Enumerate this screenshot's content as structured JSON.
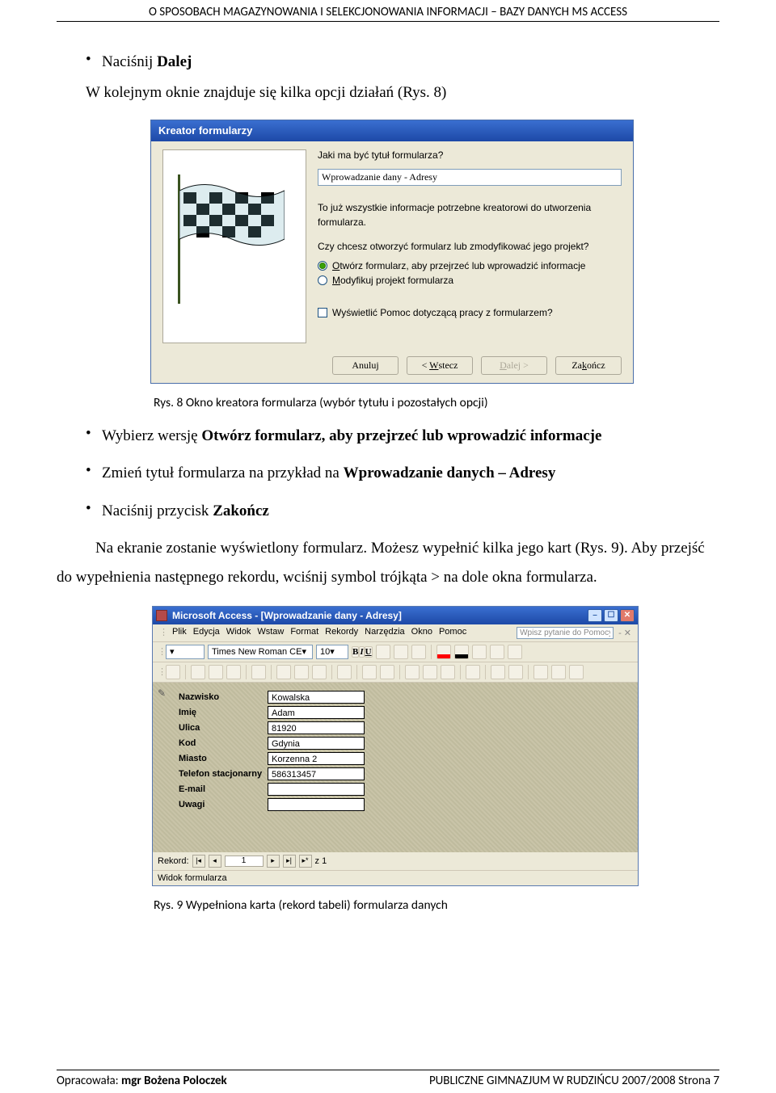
{
  "header": "O SPOSOBACH MAGAZYNOWANIA I SELEKCJONOWANIA INFORMACJI – BAZY DANYCH MS ACCESS",
  "footer": {
    "left_prefix": "Opracowała: ",
    "left_bold": "mgr Bożena Poloczek",
    "right": "PUBLICZNE GIMNAZJUM W RUDZIŃCU 2007/2008       Strona 7"
  },
  "intro": {
    "bullet1": "Naciśnij ",
    "bullet1_bold": "Dalej",
    "line2": "W kolejnym oknie znajduje się kilka opcji działań (Rys. 8)"
  },
  "wizard": {
    "title": "Kreator formularzy",
    "question": "Jaki ma być tytuł formularza?",
    "input_value": "Wprowadzanie dany - Adresy",
    "para1": "To już wszystkie informacje potrzebne kreatorowi do utworzenia formularza.",
    "para2": "Czy chcesz otworzyć formularz lub zmodyfikować jego projekt?",
    "radio1_u": "O",
    "radio1_rest": "twórz formularz, aby przejrzeć lub wprowadzić informacje",
    "radio2_u": "M",
    "radio2_rest": "odyfikuj projekt formularza",
    "check": "Wyświetlić Pomoc dotyczącą pracy z formularzem?",
    "btn_cancel": "Anuluj",
    "btn_back_pref": "< ",
    "btn_back_u": "W",
    "btn_back_rest": "stecz",
    "btn_next_u": "D",
    "btn_next_rest": "alej >",
    "btn_finish": "Za",
    "btn_finish_u": "k",
    "btn_finish_rest": "ończ"
  },
  "caption1": "Rys. 8  Okno kreatora formularza (wybór tytułu i pozostałych opcji)",
  "mid_bullets": {
    "b1_a": "Wybierz wersję ",
    "b1_b": "Otwórz formularz, aby przejrzeć lub wprowadzić informacje",
    "b2_a": "Zmień tytuł formularza na przykład na ",
    "b2_b": "Wprowadzanie danych – Adresy",
    "b3_a": "Naciśnij przycisk ",
    "b3_b": "Zakończ"
  },
  "bodytext": "Na ekranie zostanie wyświetlony formularz. Możesz wypełnić kilka jego kart (Rys. 9). Aby przejść do wypełnienia następnego rekordu, wciśnij symbol trójkąta > na dole okna formularza.",
  "access": {
    "title": "Microsoft Access - [Wprowadzanie dany - Adresy]",
    "menu": [
      "Plik",
      "Edycja",
      "Widok",
      "Wstaw",
      "Format",
      "Rekordy",
      "Narzędzia",
      "Okno",
      "Pomoc"
    ],
    "help_placeholder": "Wpisz pytanie do Pomocy",
    "help_sfx": "- ✕",
    "font_name": "Times New Roman CE",
    "font_size": "10",
    "fmt_btns": [
      "B",
      "I",
      "U"
    ],
    "fields": [
      {
        "label": "Nazwisko",
        "value": "Kowalska"
      },
      {
        "label": "Imię",
        "value": "Adam"
      },
      {
        "label": "Ulica",
        "value": "81920"
      },
      {
        "label": "Kod",
        "value": "Gdynia"
      },
      {
        "label": "Miasto",
        "value": "Korzenna 2"
      },
      {
        "label": "Telefon stacjonarny",
        "value": "586313457"
      },
      {
        "label": "E-mail",
        "value": ""
      },
      {
        "label": "Uwagi",
        "value": ""
      }
    ],
    "rec_label": "Rekord:",
    "rec_value": "1",
    "rec_count": "z  1",
    "status": "Widok formularza"
  },
  "caption2": "Rys. 9  Wypełniona karta (rekord tabeli) formularza danych"
}
